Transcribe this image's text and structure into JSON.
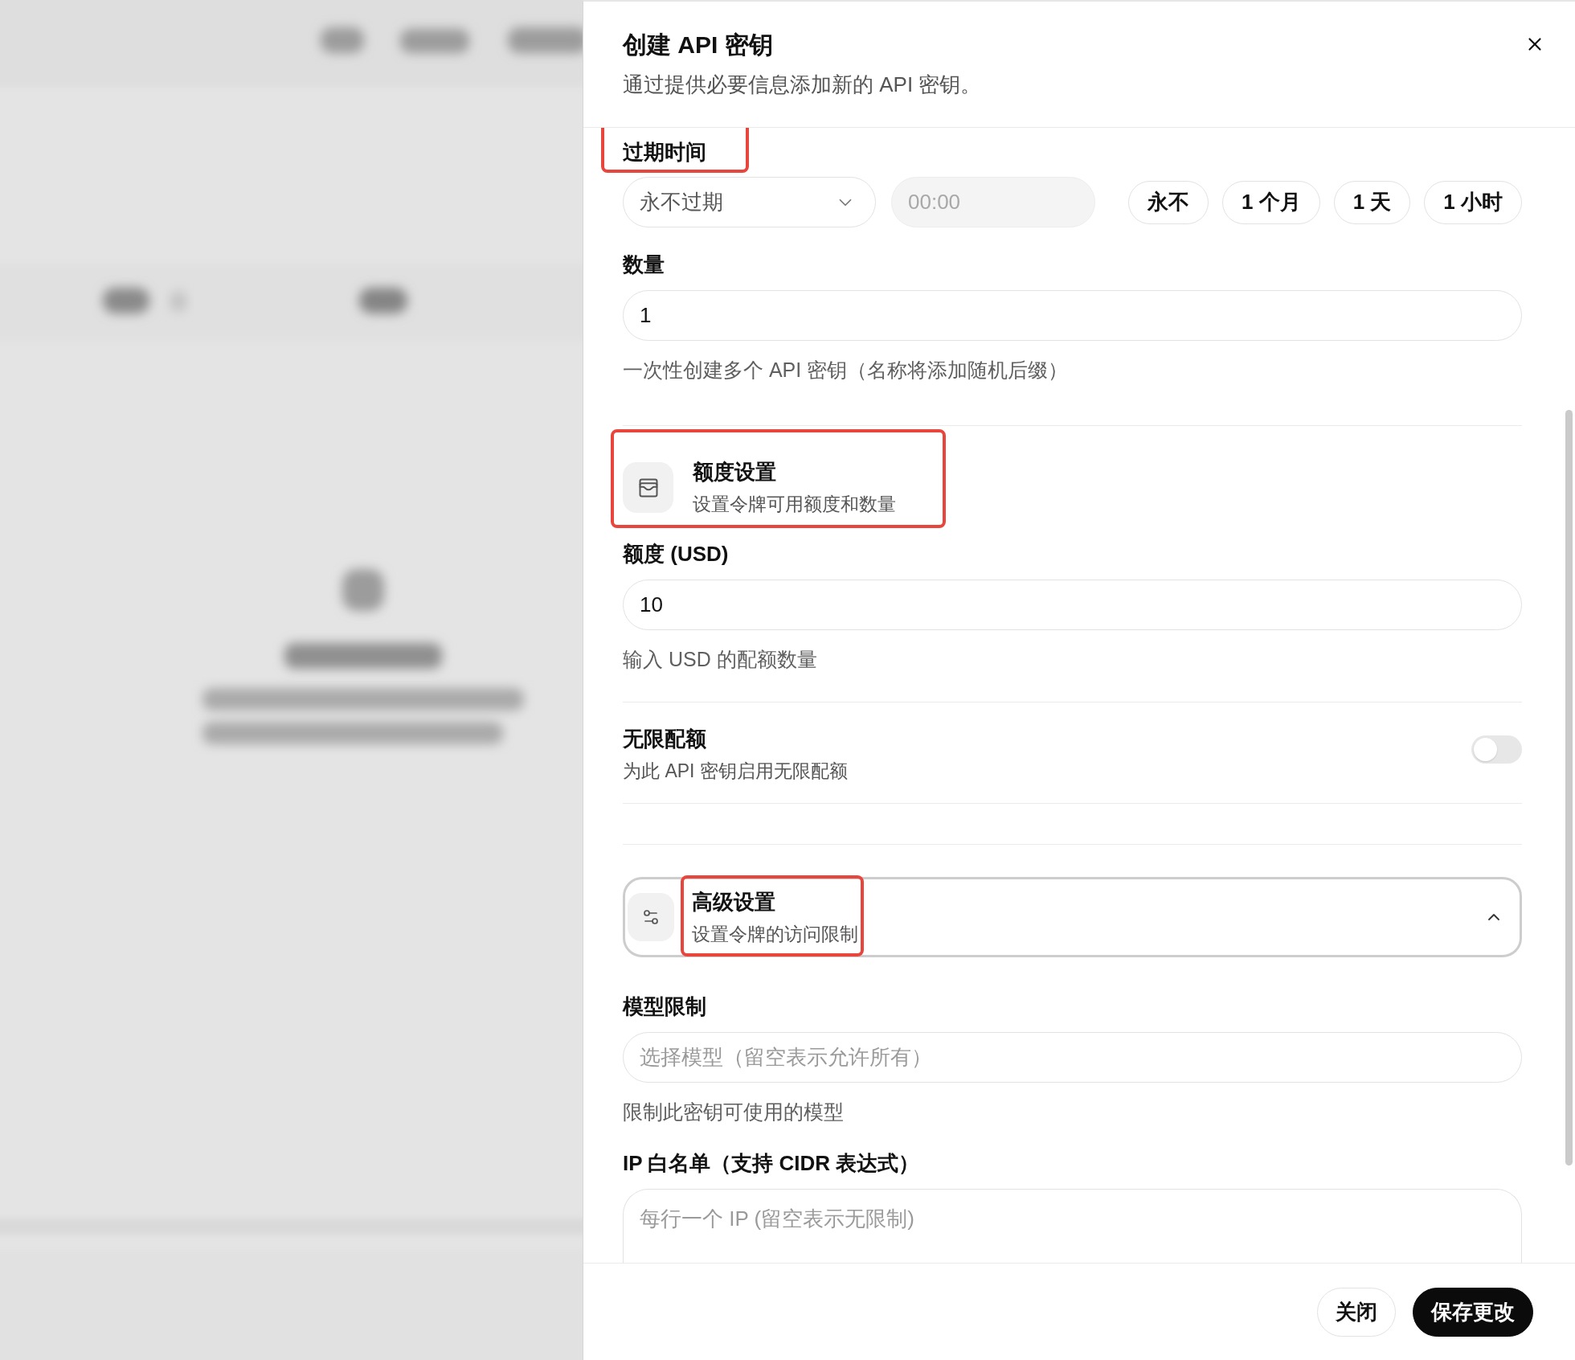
{
  "dialog": {
    "title": "创建 API 密钥",
    "subtitle": "通过提供必要信息添加新的 API 密钥。"
  },
  "form": [
    {
      "kind": "expiry",
      "label": "过期时间",
      "highlighted": true,
      "select": {
        "value": "永不过期"
      },
      "time": {
        "value": "00:00",
        "disabled": true
      },
      "presets": [
        "永不",
        "1 个月",
        "1 天",
        "1 小时"
      ]
    },
    {
      "kind": "text_input",
      "label": "数量",
      "highlighted": false,
      "value": "1",
      "help": "一次性创建多个 API 密钥（名称将添加随机后缀）"
    },
    {
      "kind": "section_header",
      "title": "额度设置",
      "subtitle": "设置令牌可用额度和数量",
      "highlighted": true
    },
    {
      "kind": "text_input",
      "label": "额度 (USD)",
      "highlighted": false,
      "value": "10",
      "help": "输入 USD 的配额数量"
    },
    {
      "kind": "toggle",
      "label": "无限配额",
      "description": "为此 API 密钥启用无限配额",
      "highlighted": false,
      "on": false
    },
    {
      "kind": "collapsible",
      "title": "高级设置",
      "subtitle": "设置令牌的访问限制",
      "highlighted": true,
      "expanded": true
    },
    {
      "kind": "text_input",
      "label": "模型限制",
      "highlighted": false,
      "placeholder": "选择模型（留空表示允许所有）",
      "help": "限制此密钥可使用的模型"
    },
    {
      "kind": "textarea",
      "label": "IP 白名单（支持 CIDR 表达式）",
      "highlighted": false,
      "placeholder": "每行一个 IP (留空表示无限制)"
    }
  ],
  "footer": {
    "buttons": [
      {
        "label": "关闭",
        "kind": "secondary"
      },
      {
        "label": "保存更改",
        "kind": "primary"
      }
    ]
  }
}
